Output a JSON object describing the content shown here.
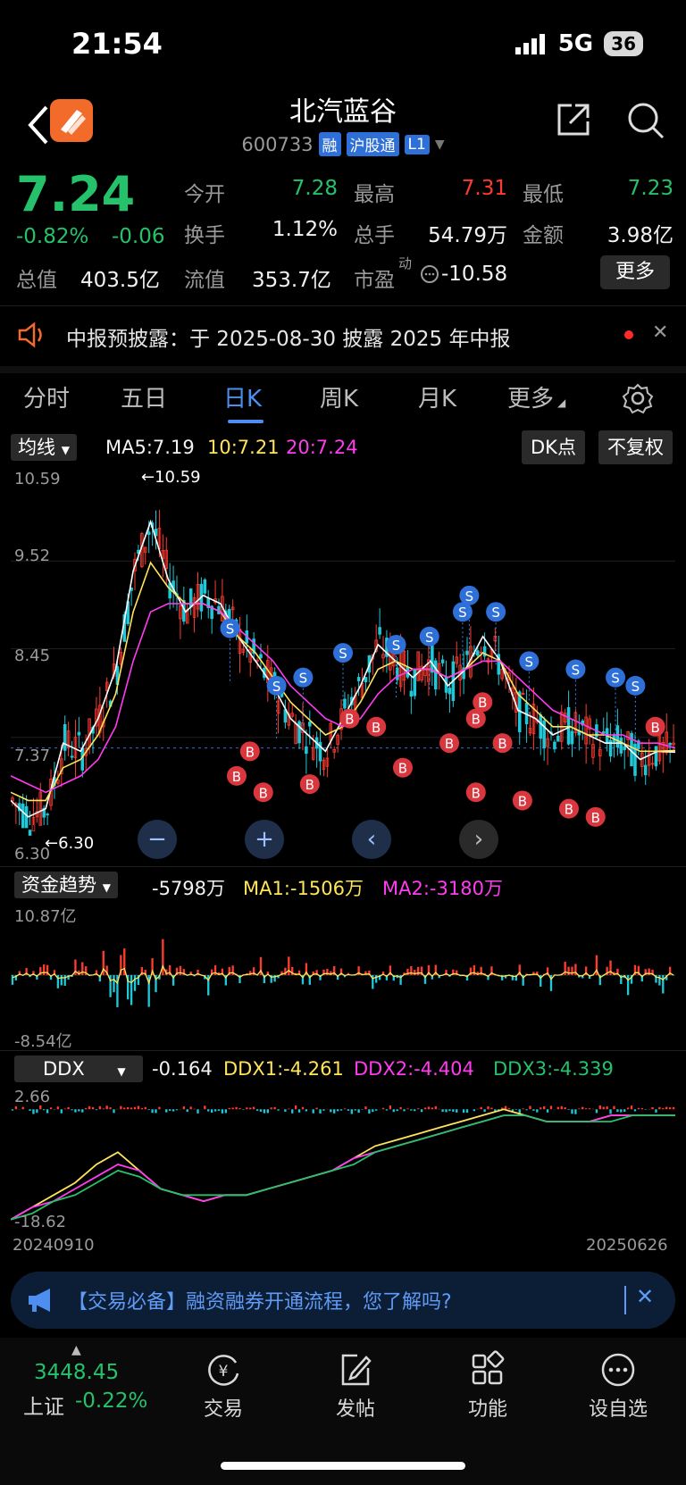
{
  "status": {
    "time": "21:54",
    "network": "5G",
    "battery": "36"
  },
  "header": {
    "title": "北汽蓝谷",
    "code": "600733",
    "tags": [
      "融",
      "沪股通",
      "L1"
    ]
  },
  "quote": {
    "price": "7.24",
    "change_pct": "-0.82%",
    "change": "-0.06",
    "fields": {
      "open_label": "今开",
      "open": "7.28",
      "high_label": "最高",
      "high": "7.31",
      "low_label": "最低",
      "low": "7.23",
      "turnover_label": "换手",
      "turnover": "1.12%",
      "volume_label": "总手",
      "volume": "54.79万",
      "amount_label": "金额",
      "amount": "3.98亿",
      "mktcap_label": "总值",
      "mktcap": "403.5亿",
      "float_label": "流值",
      "float": "353.7亿",
      "pe_label": "市盈",
      "pe_sup": "动",
      "pe": "-10.58"
    },
    "more_label": "更多"
  },
  "notice": {
    "text": "中报预披露：于 2025-08-30 披露 2025 年中报"
  },
  "tabs": [
    {
      "label": "分时"
    },
    {
      "label": "五日"
    },
    {
      "label": "日K"
    },
    {
      "label": "周K"
    },
    {
      "label": "月K"
    },
    {
      "label": "更多"
    }
  ],
  "kline_bar": {
    "select": "均线",
    "ma5": "MA5:7.19",
    "ma10": "10:7.21",
    "ma20": "20:7.24",
    "dk_label": "DK点",
    "adj_label": "不复权"
  },
  "fund_bar": {
    "select": "资金趋势",
    "value": "-5798万",
    "ma1": "MA1:-1506万",
    "ma2": "MA2:-3180万"
  },
  "ddx_bar": {
    "select": "DDX",
    "value": "-0.164",
    "ddx1": "DDX1:-4.261",
    "ddx2": "DDX2:-4.404",
    "ddx3": "DDX3:-4.339"
  },
  "chart_data": [
    {
      "type": "line",
      "title": "",
      "y_ticks": [
        "10.59",
        "9.52",
        "8.45",
        "7.37",
        "6.30"
      ],
      "ylim": [
        6.3,
        10.59
      ],
      "high_annotation": "10.59",
      "low_annotation": "6.30",
      "series": [
        {
          "name": "MA5",
          "values": [
            6.6,
            6.4,
            6.5,
            7.3,
            7.2,
            7.6,
            8.2,
            9.4,
            10.0,
            9.3,
            8.9,
            9.1,
            9.0,
            8.6,
            8.3,
            8.0,
            7.6,
            7.4,
            7.2,
            7.6,
            8.0,
            8.5,
            8.3,
            8.1,
            8.3,
            8.0,
            8.2,
            8.6,
            8.3,
            7.7,
            7.6,
            7.4,
            7.5,
            7.4,
            7.3,
            7.3,
            7.1,
            7.2,
            7.19
          ]
        },
        {
          "name": "10",
          "values": [
            6.7,
            6.6,
            6.6,
            7.0,
            7.1,
            7.4,
            7.9,
            8.9,
            9.5,
            9.2,
            9.0,
            9.0,
            8.9,
            8.6,
            8.4,
            8.1,
            7.8,
            7.6,
            7.4,
            7.5,
            7.8,
            8.2,
            8.3,
            8.2,
            8.2,
            8.1,
            8.2,
            8.4,
            8.3,
            7.9,
            7.7,
            7.5,
            7.5,
            7.4,
            7.4,
            7.3,
            7.2,
            7.2,
            7.21
          ]
        },
        {
          "name": "20",
          "values": [
            6.9,
            6.8,
            6.7,
            6.8,
            6.9,
            7.1,
            7.5,
            8.3,
            8.9,
            9.0,
            9.0,
            9.0,
            8.9,
            8.7,
            8.5,
            8.3,
            8.0,
            7.8,
            7.6,
            7.5,
            7.6,
            7.9,
            8.1,
            8.2,
            8.2,
            8.1,
            8.2,
            8.3,
            8.3,
            8.1,
            7.9,
            7.7,
            7.6,
            7.5,
            7.4,
            7.4,
            7.3,
            7.3,
            7.24
          ]
        }
      ]
    },
    {
      "type": "bar",
      "title": "",
      "y_ticks": [
        "10.87亿",
        "-8.54亿"
      ],
      "ylim": [
        -8.54,
        10.87
      ]
    },
    {
      "type": "line",
      "title": "",
      "y_ticks": [
        "2.66",
        "-18.62"
      ],
      "ylim": [
        -18.62,
        2.66
      ],
      "x_ticks": [
        "20240910",
        "20250626"
      ],
      "series": [
        {
          "name": "DDX1",
          "values": [
            -18,
            -16,
            -14,
            -12,
            -9,
            -7,
            -10,
            -13,
            -14,
            -15,
            -14,
            -14,
            -13,
            -12,
            -11,
            -10,
            -8,
            -6,
            -5,
            -4,
            -3,
            -2,
            -1,
            0,
            -1,
            -2,
            -2,
            -2,
            -1,
            -1,
            -1,
            -1
          ]
        },
        {
          "name": "DDX2",
          "values": [
            -18,
            -16,
            -15,
            -13,
            -11,
            -9,
            -10,
            -13,
            -14,
            -15,
            -14,
            -14,
            -13,
            -12,
            -11,
            -10,
            -8,
            -7,
            -6,
            -5,
            -4,
            -3,
            -2,
            -1,
            -1,
            -2,
            -2,
            -2,
            -1,
            -1,
            -1,
            -1
          ]
        },
        {
          "name": "DDX3",
          "values": [
            -18,
            -17,
            -15,
            -14,
            -12,
            -10,
            -11,
            -13,
            -14,
            -14,
            -14,
            -14,
            -13,
            -12,
            -11,
            -10,
            -9,
            -7,
            -6,
            -5,
            -4,
            -3,
            -2,
            -1,
            -1,
            -2,
            -2,
            -2,
            -2,
            -1,
            -1,
            -1
          ]
        }
      ]
    }
  ],
  "banner": {
    "text": "【交易必备】融资融券开通流程，您了解吗?"
  },
  "bottom_nav": {
    "index_value": "3448.45",
    "index_name": "上证",
    "index_pct": "-0.22%",
    "items": [
      {
        "label": "交易"
      },
      {
        "label": "发帖"
      },
      {
        "label": "功能"
      },
      {
        "label": "设自选"
      }
    ]
  },
  "colors": {
    "up": "#ff3b30",
    "down": "#25c26b",
    "accent": "#4d8ef0",
    "ma5": "#ffffff",
    "ma10": "#ffe45c",
    "ma20": "#ff3cf0"
  }
}
